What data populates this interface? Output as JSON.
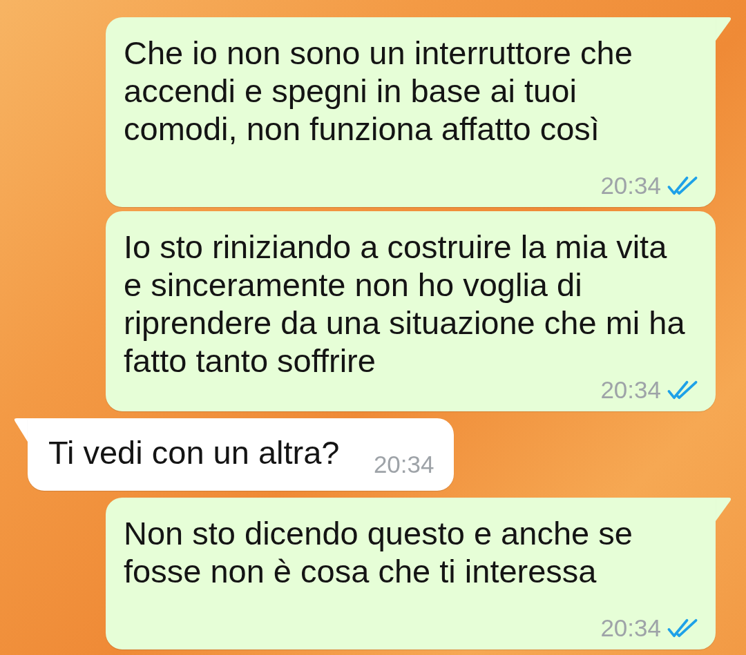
{
  "messages": [
    {
      "kind": "outgoing",
      "text": "Che io non sono un interruttore che accendi e spegni in base ai tuoi comodi, non funziona affatto così",
      "time": "20:34",
      "read": true,
      "tail": true
    },
    {
      "kind": "outgoing",
      "text": "Io sto riniziando a costruire la mia vita e sinceramente non ho voglia di riprendere da una situazione che mi ha fatto tanto soffrire",
      "time": "20:34",
      "read": true,
      "tail": false
    },
    {
      "kind": "incoming",
      "text": "Ti vedi con un altra?",
      "time": "20:34",
      "tail": true
    },
    {
      "kind": "outgoing",
      "text": "Non sto dicendo questo e anche se fosse non è cosa che ti interessa",
      "time": "20:34",
      "read": true,
      "tail": true
    }
  ]
}
